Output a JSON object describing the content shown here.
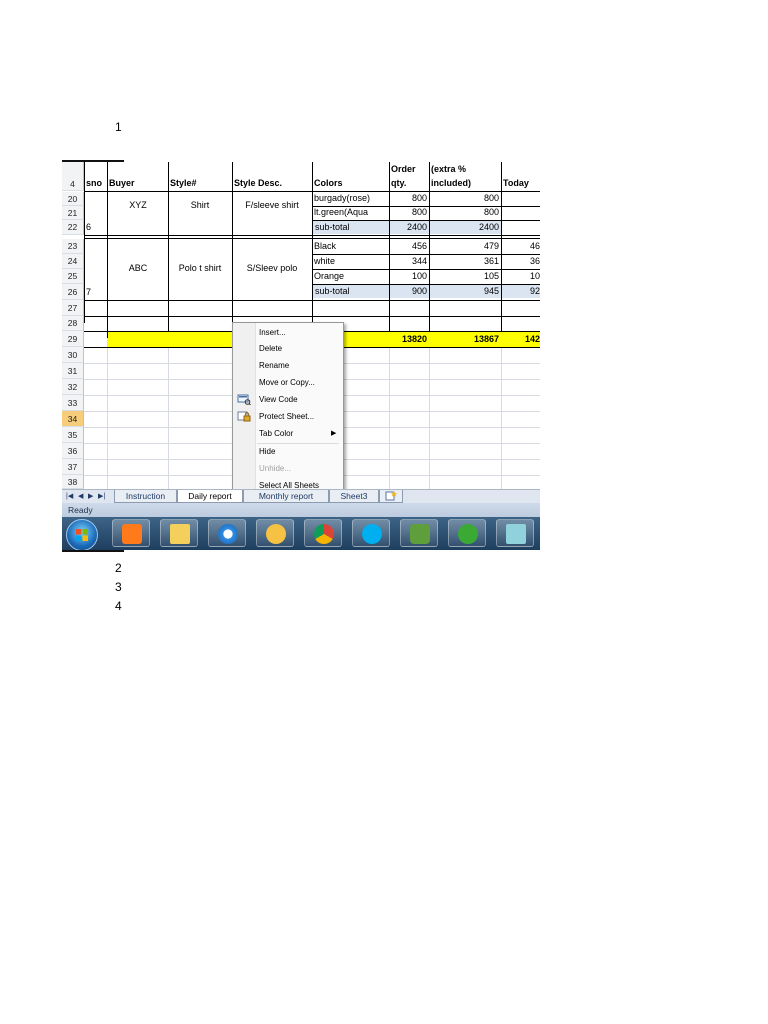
{
  "page_numbers": [
    "1",
    "2",
    "3",
    "4"
  ],
  "spreadsheet": {
    "header_row": {
      "row": "4",
      "cols": [
        "sno",
        "Buyer",
        "Style#",
        "Style Desc.",
        "Colors",
        "Order qty.",
        "(extra % included)",
        "Today"
      ],
      "order_line1": "Order",
      "order_line2": "qty.",
      "extra_line1": "(extra %",
      "extra_line2": "included)"
    },
    "row_numbers": [
      "20",
      "21",
      "22",
      "23",
      "24",
      "25",
      "26",
      "27",
      "28",
      "29",
      "30",
      "31",
      "32",
      "33",
      "34",
      "35",
      "36",
      "37",
      "38"
    ],
    "selected_row": "34",
    "group1": {
      "sno": "6",
      "buyer": "XYZ",
      "style": "Shirt",
      "desc": "F/sleeve shirt",
      "rows": [
        {
          "color": "burgady(rose)",
          "qty": "800",
          "extra": "800",
          "today": ""
        },
        {
          "color": "lt.green(Aqua",
          "qty": "800",
          "extra": "800",
          "today": ""
        }
      ],
      "subtotal": {
        "label": "sub-total",
        "qty": "2400",
        "extra": "2400",
        "today": ""
      }
    },
    "group2": {
      "sno": "7",
      "buyer": "ABC",
      "style": "Polo t shirt",
      "desc": "S/Sleev polo",
      "rows": [
        {
          "color": "Black",
          "qty": "456",
          "extra": "479",
          "today": "46"
        },
        {
          "color": "white",
          "qty": "344",
          "extra": "361",
          "today": "36"
        },
        {
          "color": "Orange",
          "qty": "100",
          "extra": "105",
          "today": "10"
        }
      ],
      "subtotal": {
        "label": "sub-total",
        "qty": "900",
        "extra": "945",
        "today": "92"
      }
    },
    "total_row": {
      "qty": "13820",
      "extra": "13867",
      "today": "142"
    },
    "colors": {
      "subtotal_fill": "#dbe5f1",
      "total_fill": "#ffff00",
      "selected_row_header": "#f7cc7a"
    }
  },
  "context_menu": {
    "items": [
      {
        "label": "Insert...",
        "enabled": true,
        "icon": ""
      },
      {
        "label": "Delete",
        "enabled": true,
        "icon": ""
      },
      {
        "label": "Rename",
        "enabled": true,
        "icon": ""
      },
      {
        "label": "Move or Copy...",
        "enabled": true,
        "icon": ""
      },
      {
        "label": "View Code",
        "enabled": true,
        "icon": "view-code-icon"
      },
      {
        "label": "Protect Sheet...",
        "enabled": true,
        "icon": "protect-sheet-icon"
      },
      {
        "label": "Tab Color",
        "enabled": true,
        "icon": "",
        "submenu": true
      },
      {
        "label": "Hide",
        "enabled": true,
        "icon": ""
      },
      {
        "label": "Unhide...",
        "enabled": false,
        "icon": ""
      },
      {
        "label": "Select All Sheets",
        "enabled": true,
        "icon": ""
      }
    ]
  },
  "sheet_tabs": {
    "tabs": [
      "Instruction",
      "Daily report",
      "Monthly report",
      "Sheet3"
    ],
    "active": "Daily report"
  },
  "status_bar": {
    "text": "Ready"
  },
  "taskbar": {
    "icons": [
      "start-orb",
      "media-player-icon",
      "folder-icon",
      "internet-explorer-icon",
      "outlook-icon",
      "chrome-icon",
      "skype-icon",
      "evernote-icon",
      "phone-app-icon",
      "notes-app-icon"
    ]
  }
}
